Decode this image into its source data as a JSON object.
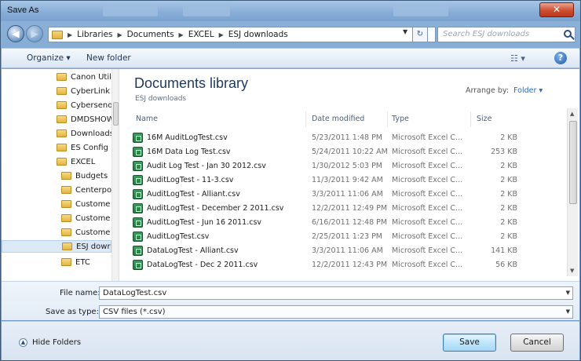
{
  "window": {
    "title": "Save As",
    "close_label": "✕"
  },
  "address": {
    "crumbs": [
      "Libraries",
      "Documents",
      "EXCEL",
      "ESJ downloads"
    ],
    "search_placeholder": "Search ESJ downloads"
  },
  "toolbar": {
    "organize": "Organize ▾",
    "new_folder": "New folder"
  },
  "sidebar": {
    "items": [
      {
        "label": "Canon Utili"
      },
      {
        "label": "CyberLink"
      },
      {
        "label": "Cybersenoc"
      },
      {
        "label": "DMDSHOW"
      },
      {
        "label": "Downloads"
      },
      {
        "label": "ES Config F"
      },
      {
        "label": "EXCEL"
      },
      {
        "label": "Budgets"
      },
      {
        "label": "Centerpo"
      },
      {
        "label": "Custome"
      },
      {
        "label": "Custome"
      },
      {
        "label": "Custome"
      },
      {
        "label": "ESJ dowr"
      },
      {
        "label": "ETC"
      }
    ]
  },
  "library": {
    "title": "Documents library",
    "subtitle": "ESJ downloads",
    "arrange_by_label": "Arrange by:",
    "arrange_by_value": "Folder ▾"
  },
  "columns": {
    "name": "Name",
    "date": "Date modified",
    "type": "Type",
    "size": "Size"
  },
  "files": [
    {
      "name": "16M AuditLogTest.csv",
      "date": "5/23/2011 1:48 PM",
      "type": "Microsoft Excel C...",
      "size": "2 KB"
    },
    {
      "name": "16M Data Log Test.csv",
      "date": "5/24/2011 10:22 AM",
      "type": "Microsoft Excel C...",
      "size": "253 KB"
    },
    {
      "name": "Audit Log Test - Jan 30 2012.csv",
      "date": "1/30/2012 5:03 PM",
      "type": "Microsoft Excel C...",
      "size": "2 KB"
    },
    {
      "name": "AuditLogTest - 11-3.csv",
      "date": "11/3/2011 9:42 AM",
      "type": "Microsoft Excel C...",
      "size": "2 KB"
    },
    {
      "name": "AuditLogTest - Alliant.csv",
      "date": "3/3/2011 11:06 AM",
      "type": "Microsoft Excel C...",
      "size": "2 KB"
    },
    {
      "name": "AuditLogTest - December 2 2011.csv",
      "date": "12/2/2011 12:49 PM",
      "type": "Microsoft Excel C...",
      "size": "2 KB"
    },
    {
      "name": "AuditLogTest - Jun 16 2011.csv",
      "date": "6/16/2011 12:48 PM",
      "type": "Microsoft Excel C...",
      "size": "2 KB"
    },
    {
      "name": "AuditLogTest.csv",
      "date": "2/25/2011 1:23 PM",
      "type": "Microsoft Excel C...",
      "size": "2 KB"
    },
    {
      "name": "DataLogTest - Alliant.csv",
      "date": "3/3/2011 11:06 AM",
      "type": "Microsoft Excel C...",
      "size": "141 KB"
    },
    {
      "name": "DataLogTest - Dec 2 2011.csv",
      "date": "12/2/2011 12:43 PM",
      "type": "Microsoft Excel C...",
      "size": "56 KB"
    }
  ],
  "form": {
    "file_name_label": "File name:",
    "file_name_value": "DataLogTest.csv",
    "save_type_label": "Save as type:",
    "save_type_value": "CSV files (*.csv)"
  },
  "buttons": {
    "hide_folders": "Hide Folders",
    "save": "Save",
    "cancel": "Cancel"
  },
  "colors": {
    "frame": "#7aa3cf",
    "library_title": "#1e395b",
    "excel_icon": "#1f7a3e",
    "close": "#cf4d2f"
  }
}
